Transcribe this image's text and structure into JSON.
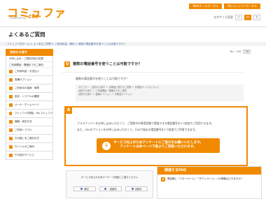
{
  "header": {
    "logo_text": "コミュファ",
    "logo_sub": "Powered by",
    "logo_ctc": "ctc",
    "top_links": [
      "Webオールポータル",
      "Myコミュファポータル"
    ],
    "font_size_label": "文字サイズ変更",
    "font_sizes": [
      "小",
      "中",
      "大"
    ]
  },
  "page": {
    "title": "よくあるご質問",
    "breadcrumb": "コミュファ光ホーム > よくあるご質問 > ご利用料金・解約 > 複数の電話番号を使うことは可能ですか？"
  },
  "sidebar": {
    "header": "目的から探す",
    "sub_items": [
      "お申し込み・ご契約内容の変更",
      "ご利用開始・開通までのご案内"
    ],
    "items": [
      "ご利用料金・お支払い",
      "各種オプション",
      "ご利用中の接続・故障",
      "設定・トラブルの確認",
      "メール・ホームページ",
      "コミュファ光電話・My.コミュファ",
      "機器・設定方法",
      "ご利用トラブル",
      "お引越しをご検討の方",
      "モバイルのご案内",
      "その他のサービス"
    ]
  },
  "question": {
    "badge": "Q",
    "no_label": "No：196",
    "print_label": "印刷",
    "title": "複数の電話番号を使うことは可能ですか？",
    "text": "複数の電話番号を使うことは可能ですか？",
    "categories": [
      "カテゴリー：目的から探す ＞ 光電話に関するご質問 ＞ 光電話サービスについて",
      "目的から探す ＞ ご利用開始・開通までのご案内",
      "目的から探す ＞ 各種オプション ＞ 光電話オプション"
    ]
  },
  "answer": {
    "badge": "A",
    "lines": [
      "プラスナンバーをお申し込みいただくと、ご契約中の専用回線で登録できる電話番号を1つ追加でご利用できます。",
      "また、050オプションをお申し込みいただくと、050で始まる電話番号を1つ追加でご利用できます。"
    ],
    "button_line1": "サービス向上のためアンケートにご協力をお願いいたします。",
    "button_line2": "アンケートは本ページ下部よりご回答いただけます。"
  },
  "survey": {
    "question": "サービス向上のためアンケート回答にご協力ください",
    "options": [
      "解決",
      "一部解決",
      "未解決"
    ]
  },
  "related_faq": {
    "title": "関連するFAQ",
    "badge": "Q",
    "item": "電話機に「ハローページ」・「タウンページ」への掲載はできますか？"
  }
}
